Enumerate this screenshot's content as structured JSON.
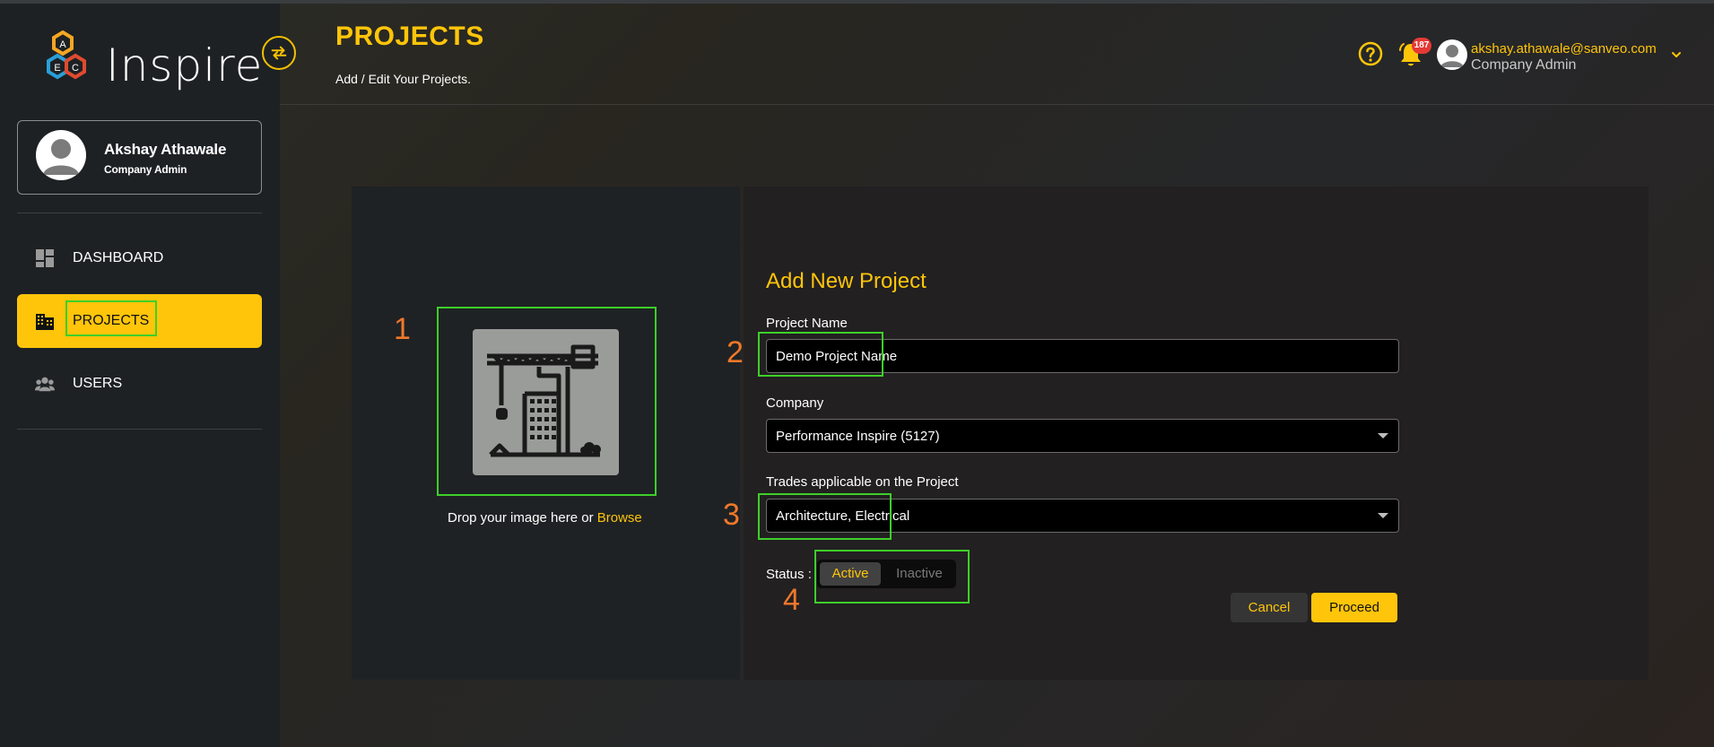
{
  "brand": {
    "logo_text": "Inspire",
    "logo_letters": [
      "A",
      "E",
      "C"
    ]
  },
  "profile": {
    "name": "Akshay Athawale",
    "role": "Company Admin"
  },
  "nav": {
    "items": [
      {
        "label": "DASHBOARD",
        "icon": "dashboard-icon",
        "active": false
      },
      {
        "label": "PROJECTS",
        "icon": "building-icon",
        "active": true
      },
      {
        "label": "USERS",
        "icon": "users-icon",
        "active": false
      }
    ]
  },
  "header": {
    "title": "PROJECTS",
    "subtitle": "Add / Edit Your Projects.",
    "notification_count": "187",
    "user_email": "akshay.athawale@sanveo.com",
    "user_role": "Company Admin"
  },
  "form": {
    "title": "Add New Project",
    "drop_text": "Drop your image here or ",
    "browse_label": "Browse",
    "project_name_label": "Project Name",
    "project_name_value": "Demo Project Name",
    "company_label": "Company",
    "company_value": "Performance Inspire (5127)",
    "trades_label": "Trades applicable on the Project",
    "trades_value": "Architecture, Electrical",
    "status_label": "Status :",
    "status_options": [
      "Active",
      "Inactive"
    ],
    "status_selected": "Active",
    "cancel_label": "Cancel",
    "proceed_label": "Proceed"
  },
  "annotations": [
    "1",
    "2",
    "3",
    "4"
  ],
  "colors": {
    "accent": "#fec50a",
    "sidebar_bg": "#1d2124",
    "annotation_box": "#3ecf2a",
    "annotation_number": "#f0782a",
    "badge": "#e53935"
  }
}
